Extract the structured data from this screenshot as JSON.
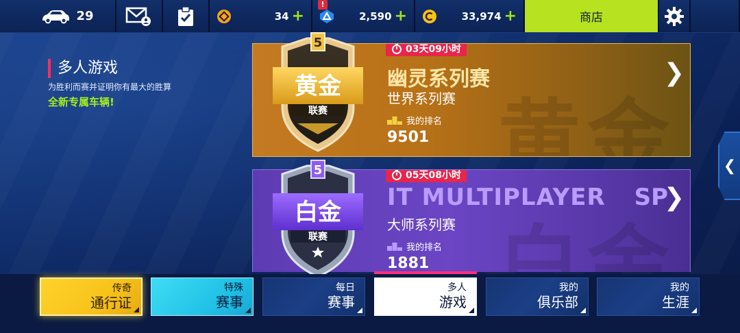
{
  "topbar": {
    "cars_count": "29",
    "tokens": "34",
    "credits": "2,590",
    "cash": "33,974",
    "plus": "+",
    "shop_label": "商店",
    "alert_badge": "!"
  },
  "promo": {
    "title": "多人游戏",
    "subtitle": "为胜利而赛并证明你有最大的胜算",
    "new_text": "全新专属车辆!"
  },
  "cards": [
    {
      "league": "黄金",
      "league_sub": "联赛",
      "tier": "5",
      "timer": "03天09小时",
      "title": "幽灵系列赛",
      "subtitle": "世界系列赛",
      "rank_label": "我的排名",
      "rank_value": "9501",
      "watermark": "黄金"
    },
    {
      "league": "白金",
      "league_sub": "联赛",
      "tier": "5",
      "timer": "05天08小时",
      "title": "IT MULTIPLAYER",
      "title_tail": "SP",
      "subtitle": "大师系列赛",
      "rank_label": "我的排名",
      "rank_value": "1881",
      "watermark": "白金"
    }
  ],
  "nav": [
    {
      "l1": "传奇",
      "l2": "通行证"
    },
    {
      "l1": "特殊",
      "l2": "赛事"
    },
    {
      "l1": "每日",
      "l2": "赛事"
    },
    {
      "l1": "多人",
      "l2": "游戏"
    },
    {
      "l1": "我的",
      "l2": "俱乐部"
    },
    {
      "l1": "我的",
      "l2": "生涯"
    }
  ],
  "colors": {
    "accent_lime": "#b6e21f",
    "gold_card": "#c47a22",
    "platinum_card": "#6b45c4",
    "timer_red": "#e8254c",
    "active_underline": "#ff2f7a"
  }
}
